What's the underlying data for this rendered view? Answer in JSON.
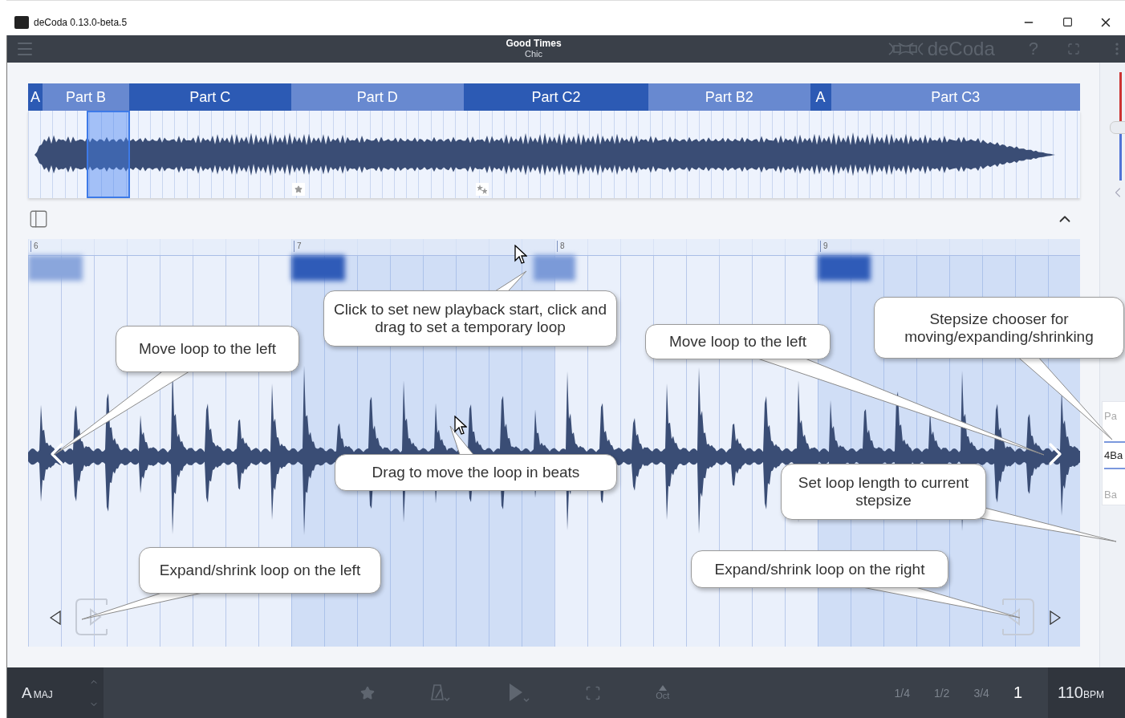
{
  "window": {
    "title": "deCoda 0.13.0-beta.5"
  },
  "header": {
    "song": "Good Times",
    "artist": "Chic",
    "logo": "deCoda",
    "help": "?"
  },
  "overview": {
    "parts": [
      {
        "label": "A",
        "color": "#2c5ab4"
      },
      {
        "label": "Part B",
        "color": "#6889d0"
      },
      {
        "label": "Part C",
        "color": "#2c5ab4"
      },
      {
        "label": "Part D",
        "color": "#6889d0"
      },
      {
        "label": "Part C2",
        "color": "#2c5ab4"
      },
      {
        "label": "Part B2",
        "color": "#6889d0"
      },
      {
        "label": "A",
        "color": "#2c5ab4"
      },
      {
        "label": "Part C3",
        "color": "#6889d0"
      }
    ]
  },
  "detail": {
    "bars": [
      "6",
      "7",
      "8",
      "9"
    ]
  },
  "callouts": [
    "Click to set new playback start, click and drag to set a temporary loop",
    "Move loop to the left",
    "Move loop to the left",
    "Stepsize chooser for moving/expanding/shrinking",
    "Drag to move the loop in beats",
    "Set loop length to current stepsize",
    "Expand/shrink loop on the left",
    "Expand/shrink loop on the right"
  ],
  "side_panel": {
    "volume": {
      "level": 0.5
    },
    "texts": [
      {
        "label": "Pa",
        "selected": false
      },
      {
        "label": "4Ba",
        "selected": true
      },
      {
        "label": "Ba",
        "selected": false
      }
    ]
  },
  "bottom_bar": {
    "key_root": "A",
    "key_mode": "MAJ",
    "octave": "Oct",
    "steps": [
      {
        "label": "1/4",
        "selected": false
      },
      {
        "label": "1/2",
        "selected": false
      },
      {
        "label": "3/4",
        "selected": false
      },
      {
        "label": "1",
        "selected": true
      }
    ],
    "tempo": "110",
    "tempo_unit": "BPM"
  }
}
